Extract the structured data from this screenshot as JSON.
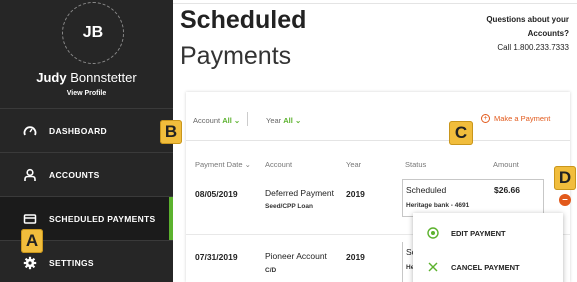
{
  "sidebar": {
    "initials": "JB",
    "first_name": "Judy",
    "last_name": "Bonnstetter",
    "view_profile": "View Profile",
    "items": [
      {
        "label": "DASHBOARD",
        "icon": "gauge-icon"
      },
      {
        "label": "ACCOUNTS",
        "icon": "user-icon"
      },
      {
        "label": "SCHEDULED PAYMENTS",
        "icon": "card-icon",
        "active": true
      },
      {
        "label": "SETTINGS",
        "icon": "gear-icon"
      }
    ]
  },
  "header": {
    "title_line1": "Scheduled",
    "title_line2": "Payments",
    "help_line1": "Questions about your",
    "help_line2": "Accounts?",
    "help_line3": "Call 1.800.233.7333"
  },
  "filters": {
    "account_label": "Account",
    "account_value": "All",
    "year_label": "Year",
    "year_value": "All",
    "make_payment": "Make a Payment"
  },
  "table": {
    "columns": [
      "Payment Date",
      "Account",
      "Year",
      "Status",
      "Amount"
    ],
    "rows": [
      {
        "date": "08/05/2019",
        "account": "Deferred Payment",
        "account_sub": "Seed/CPP Loan",
        "year": "2019",
        "status": "Scheduled",
        "status_sub": "Heritage bank - 4691",
        "amount": "$26.66"
      },
      {
        "date": "07/31/2019",
        "account": "Pioneer Account",
        "account_sub": "C/D",
        "year": "2019",
        "status": "Schedul",
        "status_sub": "Heritage",
        "amount": ""
      }
    ]
  },
  "row_menu": {
    "edit": "EDIT PAYMENT",
    "cancel": "CANCEL PAYMENT"
  },
  "callouts": {
    "a": "A",
    "b": "B",
    "c": "C",
    "d": "D"
  },
  "colors": {
    "sidebar_bg": "#262626",
    "accent_green": "#5cb22e",
    "accent_orange": "#e25a1c",
    "callout_yellow": "#f1bd3c"
  }
}
